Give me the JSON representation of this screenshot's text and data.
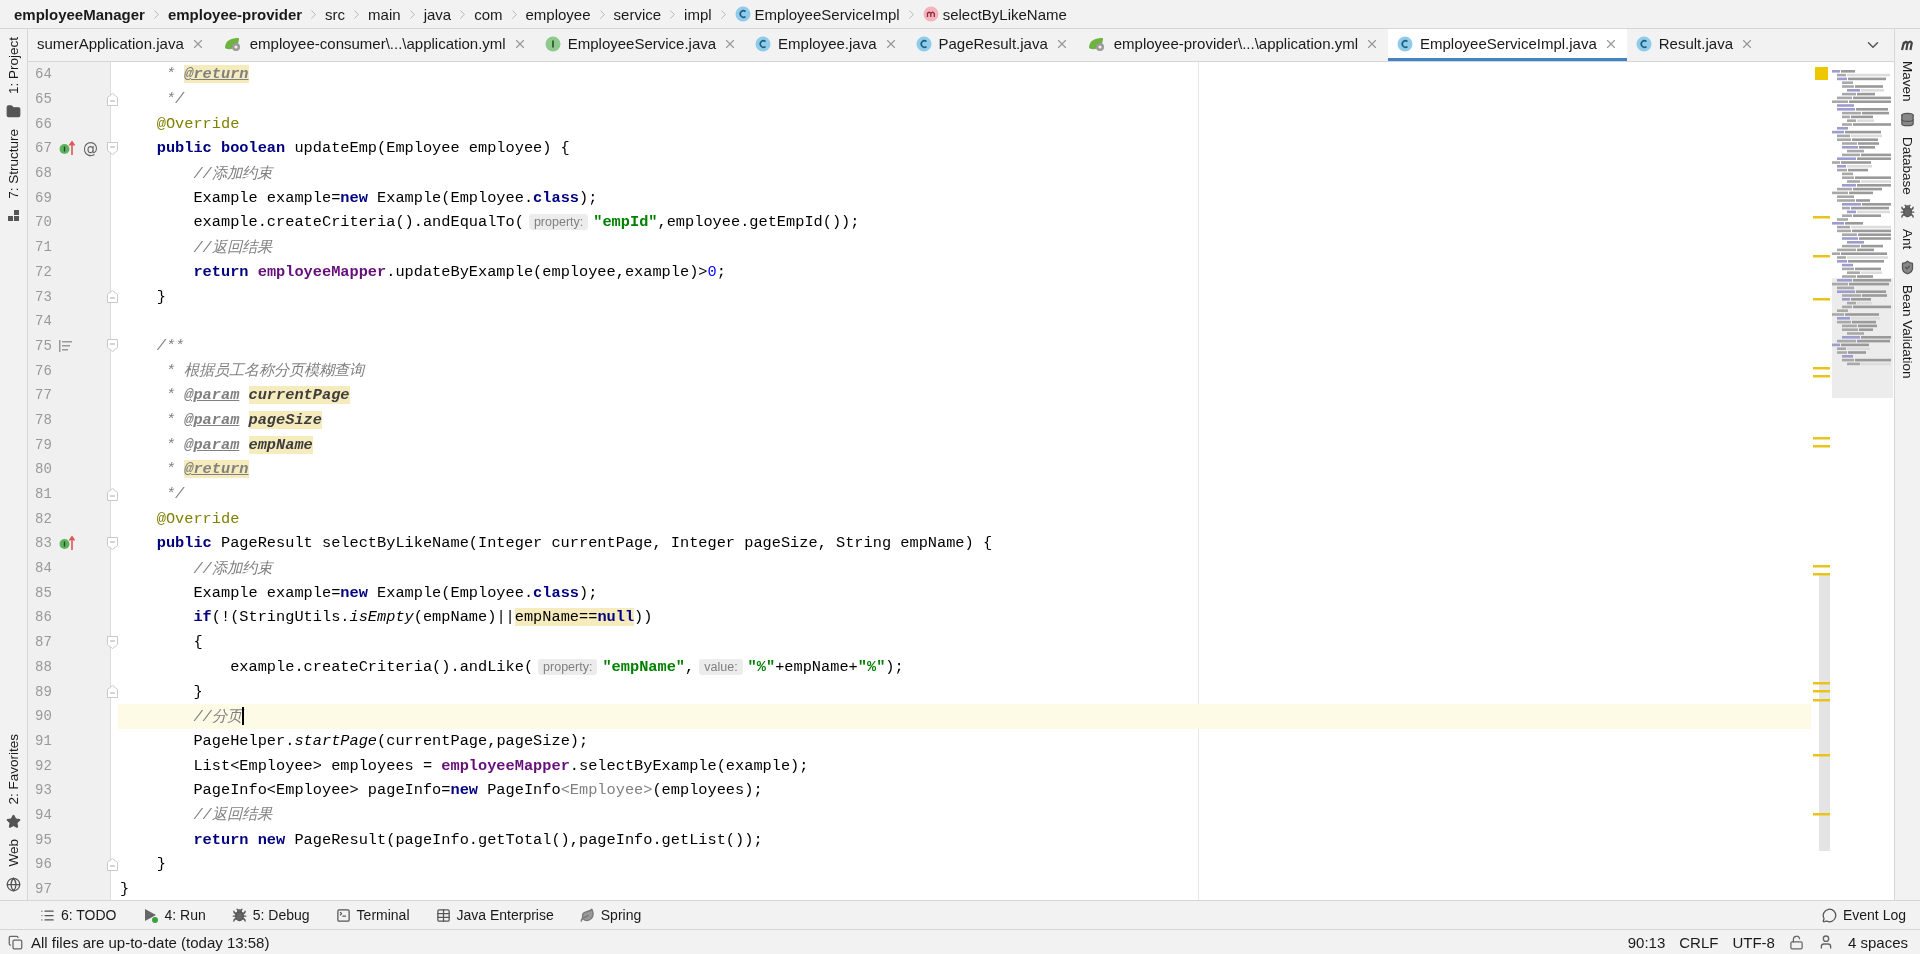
{
  "breadcrumbs": [
    {
      "label": "employeeManager",
      "kind": "module"
    },
    {
      "label": "employee-provider",
      "kind": "module"
    },
    {
      "label": "src",
      "kind": "folder"
    },
    {
      "label": "main",
      "kind": "folder"
    },
    {
      "label": "java",
      "kind": "folder"
    },
    {
      "label": "com",
      "kind": "folder"
    },
    {
      "label": "employee",
      "kind": "folder"
    },
    {
      "label": "service",
      "kind": "folder"
    },
    {
      "label": "impl",
      "kind": "folder"
    },
    {
      "label": "EmployeeServiceImpl",
      "kind": "class"
    },
    {
      "label": "selectByLikeName",
      "kind": "method"
    }
  ],
  "tabs": [
    {
      "label": "sumerApplication.java",
      "kind": "cut",
      "selected": false
    },
    {
      "label": "employee-consumer\\...\\application.yml",
      "kind": "yml",
      "selected": false
    },
    {
      "label": "EmployeeService.java",
      "kind": "interface",
      "selected": false
    },
    {
      "label": "Employee.java",
      "kind": "class",
      "selected": false
    },
    {
      "label": "PageResult.java",
      "kind": "class",
      "selected": false
    },
    {
      "label": "employee-provider\\...\\application.yml",
      "kind": "yml",
      "selected": false
    },
    {
      "label": "EmployeeServiceImpl.java",
      "kind": "class",
      "selected": true
    },
    {
      "label": "Result.java",
      "kind": "class",
      "selected": false
    }
  ],
  "left_tool_strip": {
    "top": [
      {
        "label": "1: Project",
        "kind": "folder"
      },
      {
        "label": "7: Structure",
        "kind": "structure"
      }
    ],
    "bottom": [
      {
        "label": "2: Favorites",
        "kind": "star"
      },
      {
        "label": "Web",
        "kind": "globe"
      }
    ]
  },
  "right_tool_strip": [
    {
      "label": "Maven",
      "kind": "maven"
    },
    {
      "label": "Database",
      "kind": "database"
    },
    {
      "label": "Ant",
      "kind": "ant"
    },
    {
      "label": "Bean Validation",
      "kind": "bean"
    }
  ],
  "editor": {
    "lines": [
      {
        "number": "64",
        "kind": "plain",
        "current": false,
        "segments": [
          {
            "kind": "comment",
            "text": "     * "
          },
          {
            "kind": "doc-return",
            "text": "@return"
          }
        ]
      },
      {
        "number": "65",
        "kind": "fold-end",
        "current": false,
        "segments": [
          {
            "kind": "comment",
            "text": "     */"
          }
        ]
      },
      {
        "number": "66",
        "kind": "plain",
        "current": false,
        "segments": [
          {
            "kind": "annotation",
            "text": "    @Override"
          }
        ]
      },
      {
        "number": "67",
        "kind": "fold-start",
        "current": false,
        "gutter": [
          {
            "kind": "implements"
          },
          {
            "kind": "symbol",
            "text": "@"
          }
        ],
        "segments": [
          {
            "kind": "keyword",
            "text": "    public boolean"
          },
          {
            "kind": "plain",
            "text": " updateEmp(Employee employee) {"
          }
        ]
      },
      {
        "number": "68",
        "kind": "plain",
        "current": false,
        "segments": [
          {
            "kind": "comment",
            "text": "        //添加约束"
          }
        ]
      },
      {
        "number": "69",
        "kind": "plain",
        "current": false,
        "segments": [
          {
            "kind": "plain",
            "text": "        Example example="
          },
          {
            "kind": "keyword",
            "text": "new"
          },
          {
            "kind": "plain",
            "text": " Example(Employee."
          },
          {
            "kind": "keyword",
            "text": "class"
          },
          {
            "kind": "plain",
            "text": ");"
          }
        ]
      },
      {
        "number": "70",
        "kind": "plain",
        "current": false,
        "segments": [
          {
            "kind": "plain",
            "text": "        example.createCriteria().andEqualTo("
          },
          {
            "kind": "hint",
            "text": "property:"
          },
          {
            "kind": "string",
            "text": "\"empId\""
          },
          {
            "kind": "plain",
            "text": ",employee.getEmpId());"
          }
        ]
      },
      {
        "number": "71",
        "kind": "plain",
        "current": false,
        "segments": [
          {
            "kind": "comment",
            "text": "        //返回结果"
          }
        ]
      },
      {
        "number": "72",
        "kind": "plain",
        "current": false,
        "segments": [
          {
            "kind": "keyword",
            "text": "        return "
          },
          {
            "kind": "field",
            "text": "employeeMapper"
          },
          {
            "kind": "plain",
            "text": ".updateByExample(employee,example)>"
          },
          {
            "kind": "number",
            "text": "0"
          },
          {
            "kind": "plain",
            "text": ";"
          }
        ]
      },
      {
        "number": "73",
        "kind": "fold-end",
        "current": false,
        "segments": [
          {
            "kind": "plain",
            "text": "    }"
          }
        ]
      },
      {
        "number": "74",
        "kind": "plain",
        "current": false
      },
      {
        "number": "75",
        "kind": "fold-start",
        "current": false,
        "gutter": [
          {
            "kind": "doc"
          }
        ],
        "segments": [
          {
            "kind": "comment",
            "text": "    /**"
          }
        ]
      },
      {
        "number": "76",
        "kind": "plain",
        "current": false,
        "segments": [
          {
            "kind": "comment",
            "text": "     * 根据员工名称分页模糊查询"
          }
        ]
      },
      {
        "number": "77",
        "kind": "plain",
        "current": false,
        "segments": [
          {
            "kind": "comment",
            "text": "     * "
          },
          {
            "kind": "doc-tag",
            "text": "@param"
          },
          {
            "kind": "doc-param",
            "text": "currentPage"
          }
        ]
      },
      {
        "number": "78",
        "kind": "plain",
        "current": false,
        "segments": [
          {
            "kind": "comment",
            "text": "     * "
          },
          {
            "kind": "doc-tag",
            "text": "@param"
          },
          {
            "kind": "doc-param",
            "text": "pageSize"
          }
        ]
      },
      {
        "number": "79",
        "kind": "plain",
        "current": false,
        "segments": [
          {
            "kind": "comment",
            "text": "     * "
          },
          {
            "kind": "doc-tag",
            "text": "@param"
          },
          {
            "kind": "doc-param",
            "text": "empName"
          }
        ]
      },
      {
        "number": "80",
        "kind": "plain",
        "current": false,
        "segments": [
          {
            "kind": "comment",
            "text": "     * "
          },
          {
            "kind": "doc-return",
            "text": "@return"
          }
        ]
      },
      {
        "number": "81",
        "kind": "fold-end",
        "current": false,
        "segments": [
          {
            "kind": "comment",
            "text": "     */"
          }
        ]
      },
      {
        "number": "82",
        "kind": "plain",
        "current": false,
        "segments": [
          {
            "kind": "annotation",
            "text": "    @Override"
          }
        ]
      },
      {
        "number": "83",
        "kind": "fold-start",
        "current": false,
        "gutter": [
          {
            "kind": "implements"
          }
        ],
        "segments": [
          {
            "kind": "keyword",
            "text": "    public"
          },
          {
            "kind": "plain",
            "text": " PageResult selectByLikeName(Integer currentPage, Integer pageSize, String empName) {"
          }
        ]
      },
      {
        "number": "84",
        "kind": "plain",
        "current": false,
        "segments": [
          {
            "kind": "comment",
            "text": "        //添加约束"
          }
        ]
      },
      {
        "number": "85",
        "kind": "plain",
        "current": false,
        "segments": [
          {
            "kind": "plain",
            "text": "        Example example="
          },
          {
            "kind": "keyword",
            "text": "new"
          },
          {
            "kind": "plain",
            "text": " Example(Employee."
          },
          {
            "kind": "keyword",
            "text": "class"
          },
          {
            "kind": "plain",
            "text": ");"
          }
        ]
      },
      {
        "number": "86",
        "kind": "plain",
        "current": false,
        "segments": [
          {
            "kind": "keyword",
            "text": "        if"
          },
          {
            "kind": "plain",
            "text": "(!(StringUtils."
          },
          {
            "kind": "static",
            "text": "isEmpty"
          },
          {
            "kind": "plain",
            "text": "(empName)||"
          },
          {
            "kind": "warning",
            "text": "empName=="
          },
          {
            "kind": "warning-keyword",
            "text": "null"
          },
          {
            "kind": "plain",
            "text": "))"
          }
        ]
      },
      {
        "number": "87",
        "kind": "fold-start",
        "current": false,
        "segments": [
          {
            "kind": "plain",
            "text": "        {"
          }
        ]
      },
      {
        "number": "88",
        "kind": "plain",
        "current": false,
        "segments": [
          {
            "kind": "plain",
            "text": "            example.createCriteria().andLike("
          },
          {
            "kind": "hint",
            "text": "property:"
          },
          {
            "kind": "string",
            "text": "\"empName\""
          },
          {
            "kind": "plain",
            "text": ","
          },
          {
            "kind": "hint",
            "text": "value:"
          },
          {
            "kind": "string",
            "text": "\"%\""
          },
          {
            "kind": "plain",
            "text": "+empName+"
          },
          {
            "kind": "string",
            "text": "\"%\""
          },
          {
            "kind": "plain",
            "text": ");"
          }
        ]
      },
      {
        "number": "89",
        "kind": "fold-end",
        "current": false,
        "segments": [
          {
            "kind": "plain",
            "text": "        }"
          }
        ]
      },
      {
        "number": "90",
        "kind": "plain",
        "current": true,
        "segments": [
          {
            "kind": "comment",
            "text": "        //分页"
          }
        ]
      },
      {
        "number": "91",
        "kind": "plain",
        "current": false,
        "segments": [
          {
            "kind": "plain",
            "text": "        PageHelper."
          },
          {
            "kind": "static",
            "text": "startPage"
          },
          {
            "kind": "plain",
            "text": "(currentPage,pageSize);"
          }
        ]
      },
      {
        "number": "92",
        "kind": "plain",
        "current": false,
        "segments": [
          {
            "kind": "plain",
            "text": "        List<Employee> employees = "
          },
          {
            "kind": "field",
            "text": "employeeMapper"
          },
          {
            "kind": "plain",
            "text": ".selectByExample(example);"
          }
        ]
      },
      {
        "number": "93",
        "kind": "plain",
        "current": false,
        "segments": [
          {
            "kind": "plain",
            "text": "        PageInfo<Employee> pageInfo="
          },
          {
            "kind": "keyword",
            "text": "new"
          },
          {
            "kind": "plain",
            "text": " PageInfo"
          },
          {
            "kind": "generic",
            "text": "<Employee>"
          },
          {
            "kind": "plain",
            "text": "(employees);"
          }
        ]
      },
      {
        "number": "94",
        "kind": "plain",
        "current": false,
        "segments": [
          {
            "kind": "comment",
            "text": "        //返回结果"
          }
        ]
      },
      {
        "number": "95",
        "kind": "plain",
        "current": false,
        "segments": [
          {
            "kind": "keyword",
            "text": "        return new"
          },
          {
            "kind": "plain",
            "text": " PageResult(pageInfo.getTotal(),pageInfo.getList());"
          }
        ]
      },
      {
        "number": "96",
        "kind": "fold-end",
        "current": false,
        "segments": [
          {
            "kind": "plain",
            "text": "    }"
          }
        ]
      },
      {
        "number": "97",
        "kind": "plain",
        "current": false,
        "segments": [
          {
            "kind": "plain",
            "text": "}"
          }
        ]
      }
    ]
  },
  "tool_window_bar": {
    "items": [
      {
        "label": "6: TODO",
        "kind": "todo"
      },
      {
        "label": "4: Run",
        "kind": "run"
      },
      {
        "label": "5: Debug",
        "kind": "debug"
      },
      {
        "label": "Terminal",
        "kind": "terminal"
      },
      {
        "label": "Java Enterprise",
        "kind": "enterprise"
      },
      {
        "label": "Spring",
        "kind": "spring"
      }
    ],
    "right": [
      {
        "label": "Event Log",
        "kind": "event"
      }
    ]
  },
  "status_bar": {
    "message": "All files are up-to-date (today 13:58)",
    "items": [
      {
        "kind": "text",
        "text": "90:13"
      },
      {
        "kind": "text",
        "text": "CRLF"
      },
      {
        "kind": "text",
        "text": "UTF-8"
      },
      {
        "kind": "lock"
      },
      {
        "kind": "inspector"
      },
      {
        "kind": "text",
        "text": "4 spaces"
      }
    ]
  }
}
